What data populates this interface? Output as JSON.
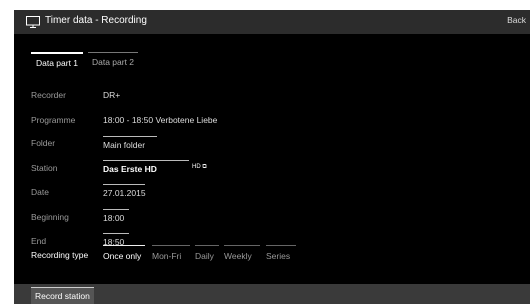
{
  "window": {
    "title": "Timer data - Recording",
    "back_label": "Back"
  },
  "tabs": [
    {
      "label": "Data part 1",
      "active": true
    },
    {
      "label": "Data part 2",
      "active": false
    }
  ],
  "fields": {
    "recorder": {
      "label": "Recorder",
      "value": "DR+"
    },
    "programme": {
      "label": "Programme",
      "value": "18:00 - 18:50 Verbotene Liebe"
    },
    "folder": {
      "label": "Folder",
      "value": "Main folder"
    },
    "station": {
      "label": "Station",
      "value": "Das Erste HD",
      "icons": "HD ⧉"
    },
    "date": {
      "label": "Date",
      "value": "27.01.2015"
    },
    "beginning": {
      "label": "Beginning",
      "value": "18:00"
    },
    "end": {
      "label": "End",
      "value": "18:50"
    }
  },
  "recording_type": {
    "label": "Recording type",
    "options": [
      "Once only",
      "Mon-Fri",
      "Daily",
      "Weekly",
      "Series"
    ],
    "selected": "Once only"
  },
  "bottom": {
    "record_station_label": "Record station"
  },
  "colors": {
    "background": "#000000",
    "titlebar": "#2c2c2c",
    "bottombar": "#3a3a3a"
  }
}
